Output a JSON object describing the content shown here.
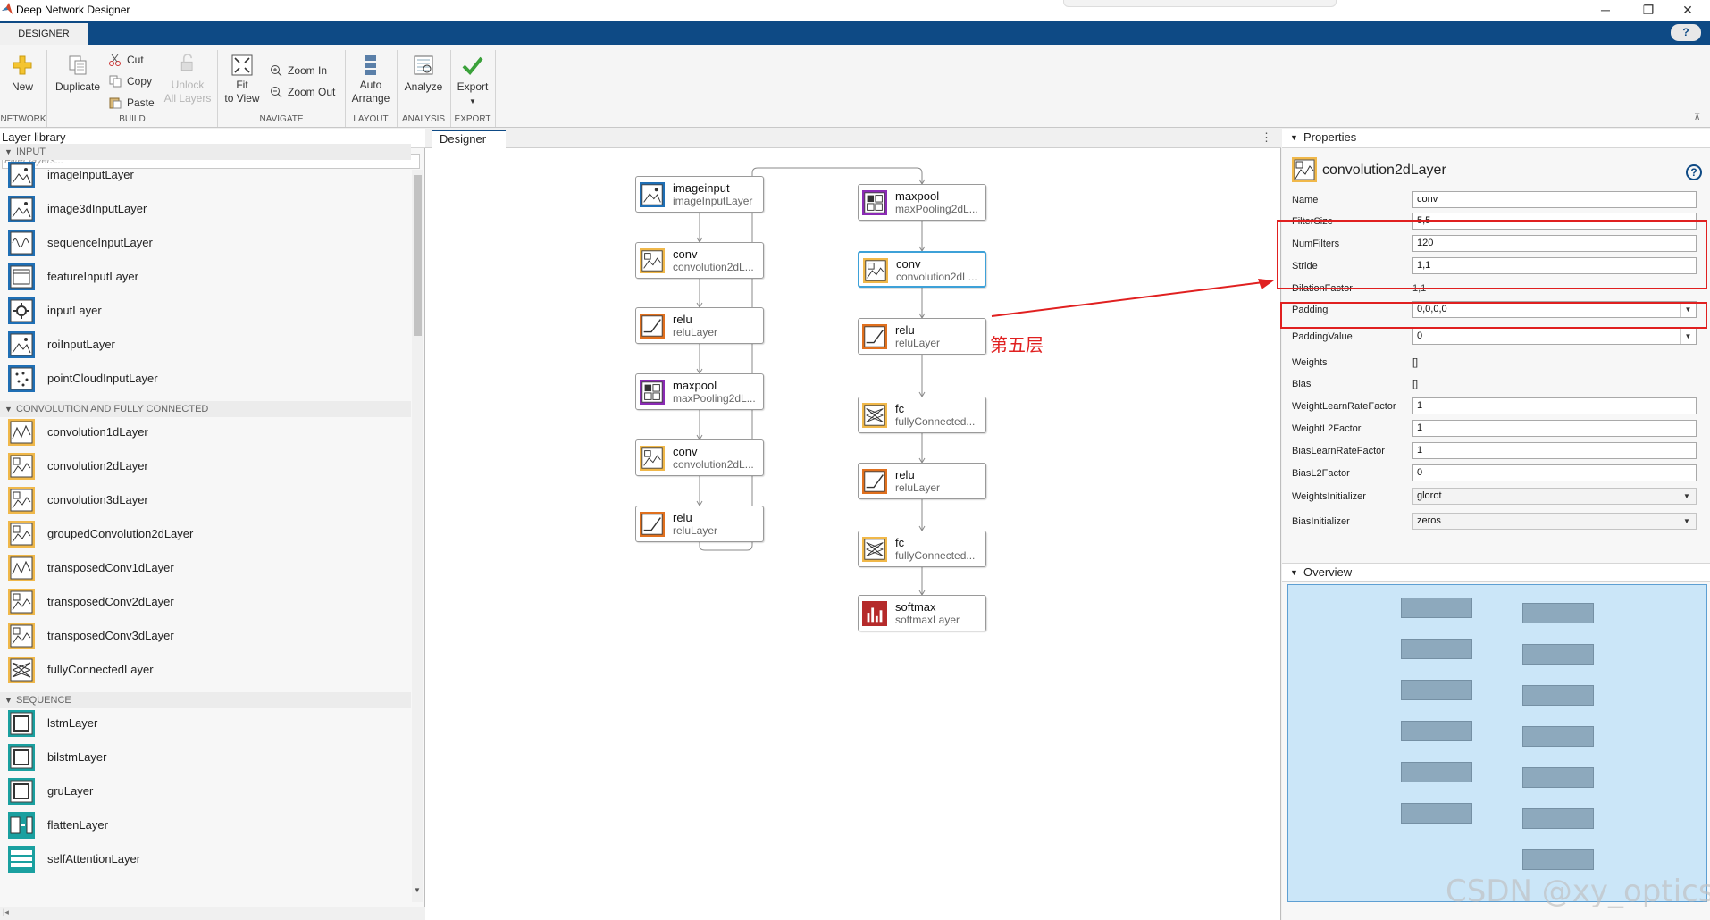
{
  "window": {
    "title": "Deep Network Designer",
    "minimize": "─",
    "maximize": "❐",
    "close": "✕"
  },
  "tabstrip": {
    "tab": "DESIGNER",
    "help": "?"
  },
  "ribbon": {
    "new": "New",
    "duplicate": "Duplicate",
    "cut": "Cut",
    "copy": "Copy",
    "paste": "Paste",
    "unlock_line1": "Unlock",
    "unlock_line2": "All Layers",
    "fit_line1": "Fit",
    "fit_line2": "to View",
    "zoom_in": "Zoom In",
    "zoom_out": "Zoom Out",
    "auto_line1": "Auto",
    "auto_line2": "Arrange",
    "analyze": "Analyze",
    "export": "Export",
    "groups": [
      "NETWORK",
      "BUILD",
      "NAVIGATE",
      "LAYOUT",
      "ANALYSIS",
      "EXPORT"
    ]
  },
  "library": {
    "title": "Layer library",
    "filter_placeholder": "Filter layers...",
    "sections": [
      {
        "name": "INPUT",
        "items": [
          "imageInputLayer",
          "image3dInputLayer",
          "sequenceInputLayer",
          "featureInputLayer",
          "inputLayer",
          "roiInputLayer",
          "pointCloudInputLayer"
        ]
      },
      {
        "name": "CONVOLUTION AND FULLY CONNECTED",
        "items": [
          "convolution1dLayer",
          "convolution2dLayer",
          "convolution3dLayer",
          "groupedConvolution2dLayer",
          "transposedConv1dLayer",
          "transposedConv2dLayer",
          "transposedConv3dLayer",
          "fullyConnectedLayer"
        ]
      },
      {
        "name": "SEQUENCE",
        "items": [
          "lstmLayer",
          "bilstmLayer",
          "gruLayer",
          "flattenLayer",
          "selfAttentionLayer"
        ]
      }
    ]
  },
  "designer": {
    "tab": "Designer",
    "menu": "⋮",
    "annotation": "第五层",
    "nodes": [
      {
        "name": "imageinput",
        "type": "imageInputLayer",
        "icon": "image-input"
      },
      {
        "name": "conv",
        "type": "convolution2dL...",
        "icon": "conv2d"
      },
      {
        "name": "relu",
        "type": "reluLayer",
        "icon": "relu"
      },
      {
        "name": "maxpool",
        "type": "maxPooling2dL...",
        "icon": "maxpool"
      },
      {
        "name": "conv",
        "type": "convolution2dL...",
        "icon": "conv2d"
      },
      {
        "name": "relu",
        "type": "reluLayer",
        "icon": "relu"
      },
      {
        "name": "maxpool",
        "type": "maxPooling2dL...",
        "icon": "maxpool"
      },
      {
        "name": "conv",
        "type": "convolution2dL...",
        "icon": "conv2d",
        "selected": true
      },
      {
        "name": "relu",
        "type": "reluLayer",
        "icon": "relu"
      },
      {
        "name": "fc",
        "type": "fullyConnected...",
        "icon": "fc"
      },
      {
        "name": "relu",
        "type": "reluLayer",
        "icon": "relu"
      },
      {
        "name": "fc",
        "type": "fullyConnected...",
        "icon": "fc"
      },
      {
        "name": "softmax",
        "type": "softmaxLayer",
        "icon": "softmax"
      }
    ]
  },
  "properties": {
    "title": "Properties",
    "layer_title": "convolution2dLayer",
    "help": "?",
    "rows": [
      {
        "label": "Name",
        "value": "conv",
        "kind": "text"
      },
      {
        "label": "FilterSize",
        "value": "5,5",
        "kind": "text"
      },
      {
        "label": "NumFilters",
        "value": "120",
        "kind": "text"
      },
      {
        "label": "Stride",
        "value": "1,1",
        "kind": "text"
      },
      {
        "label": "DilationFactor",
        "value": "1,1",
        "kind": "static"
      },
      {
        "label": "Padding",
        "value": "0,0,0,0",
        "kind": "combo"
      },
      {
        "label": "PaddingValue",
        "value": "0",
        "kind": "combo"
      },
      {
        "label": "Weights",
        "value": "[]",
        "kind": "static"
      },
      {
        "label": "Bias",
        "value": "[]",
        "kind": "static"
      },
      {
        "label": "WeightLearnRateFactor",
        "value": "1",
        "kind": "text"
      },
      {
        "label": "WeightL2Factor",
        "value": "1",
        "kind": "text"
      },
      {
        "label": "BiasLearnRateFactor",
        "value": "1",
        "kind": "text"
      },
      {
        "label": "BiasL2Factor",
        "value": "0",
        "kind": "text"
      },
      {
        "label": "WeightsInitializer",
        "value": "glorot",
        "kind": "dropdown"
      },
      {
        "label": "BiasInitializer",
        "value": "zeros",
        "kind": "dropdown"
      }
    ]
  },
  "overview": {
    "title": "Overview"
  },
  "watermark": "CSDN @xy_optics",
  "colors": {
    "accent": "#0e4a85",
    "annotation": "#e02020",
    "selection": "#3ea1d8"
  }
}
